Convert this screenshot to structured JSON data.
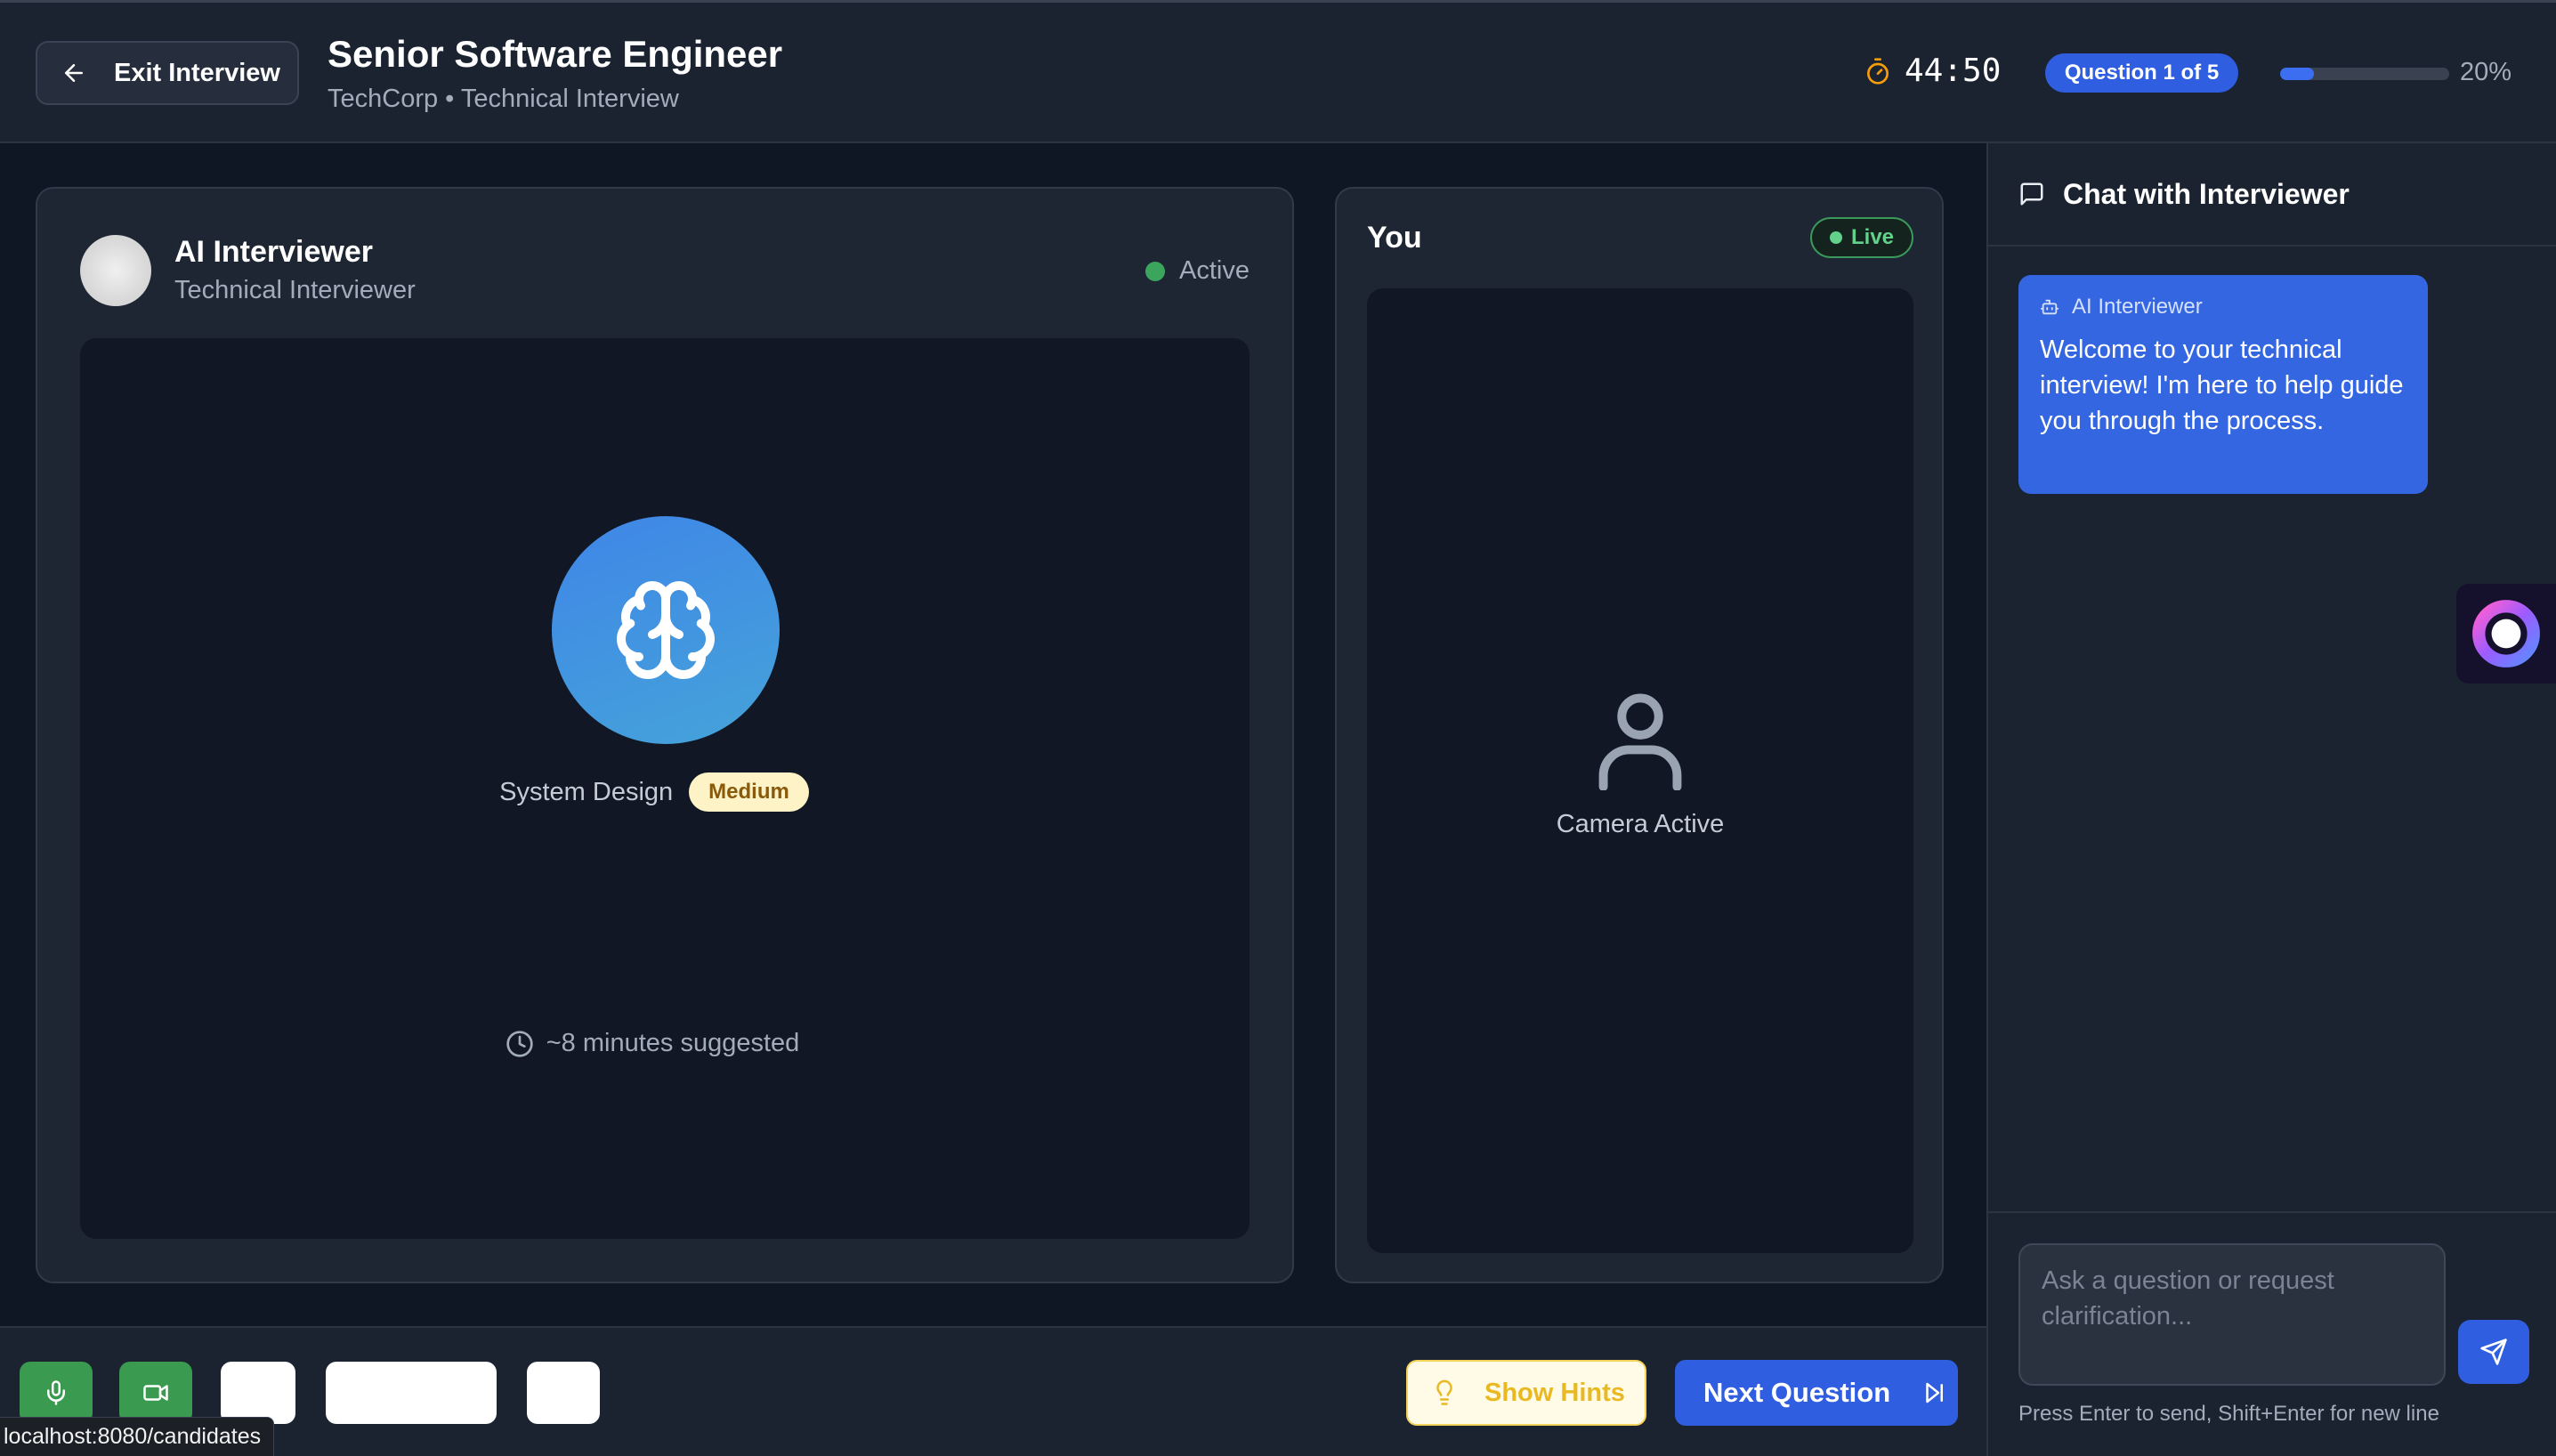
{
  "header": {
    "exit_label": "Exit Interview",
    "title": "Senior Software Engineer",
    "subtitle": "TechCorp • Technical Interview",
    "timer": "44:50",
    "question_badge": "Question 1 of 5",
    "progress_fraction": 0.2,
    "progress_text": "20%"
  },
  "interviewer": {
    "name": "AI Interviewer",
    "role": "Technical Interviewer",
    "status": "Active",
    "topic": "System Design",
    "difficulty": "Medium",
    "suggested_time": "~8 minutes suggested"
  },
  "candidate": {
    "title": "You",
    "live_label": "Live",
    "camera_status": "Camera Active"
  },
  "controls": {
    "hints_label": "Show Hints",
    "next_label": "Next Question",
    "status_url": "localhost:8080/candidates"
  },
  "chat": {
    "title": "Chat with Interviewer",
    "messages": [
      {
        "sender": "AI Interviewer",
        "text": "Welcome to your technical interview! I'm here to help guide you through the process."
      }
    ],
    "input_placeholder": "Ask a question or request clarification...",
    "hint": "Press Enter to send, Shift+Enter for new line"
  },
  "colors": {
    "accent": "#2f5fe0",
    "active": "#3ba55d",
    "timer": "#f59e0b",
    "medium_badge_bg": "#fdf3c7"
  }
}
